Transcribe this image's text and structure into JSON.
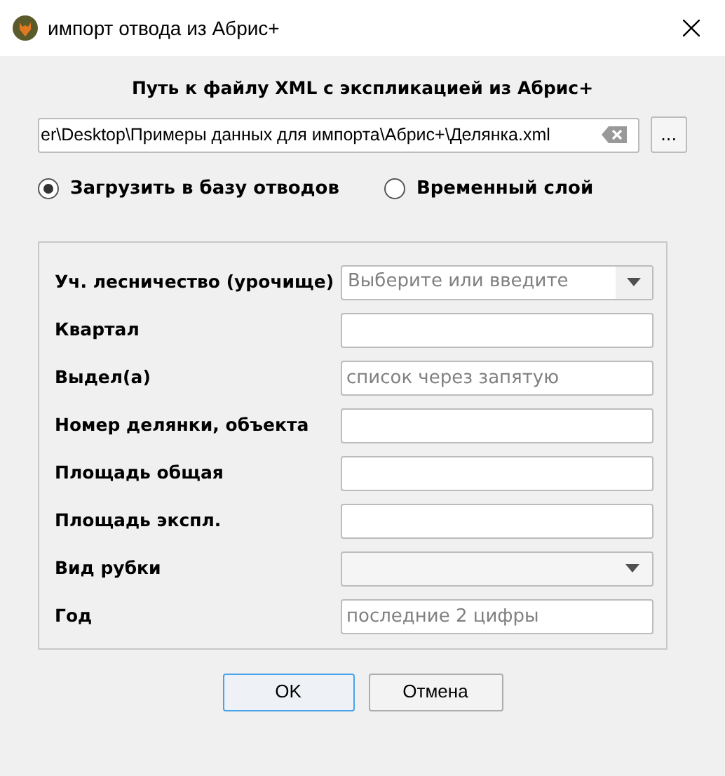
{
  "window": {
    "title": "импорт отвода из Абрис+"
  },
  "path": {
    "label": "Путь к файлу XML с экспликацией из Абрис+",
    "value": "er\\Desktop\\Примеры данных для импорта\\Абрис+\\Делянка.xml",
    "browse": "..."
  },
  "modes": [
    {
      "label": "Загрузить в базу отводов",
      "selected": true
    },
    {
      "label": "Временный слой",
      "selected": false
    }
  ],
  "fields": [
    {
      "label": "Уч. лесничество (урочище)",
      "kind": "combo",
      "placeholder": "Выберите или введите"
    },
    {
      "label": "Квартал",
      "kind": "text"
    },
    {
      "label": "Выдел(а)",
      "kind": "text",
      "placeholder": "список через запятую"
    },
    {
      "label": "Номер делянки, объекта",
      "kind": "text"
    },
    {
      "label": "Площадь общая",
      "kind": "text"
    },
    {
      "label": "Площадь экспл.",
      "kind": "text"
    },
    {
      "label": "Вид рубки",
      "kind": "dropdown"
    },
    {
      "label": "Год",
      "kind": "text",
      "placeholder": "последние 2 цифры"
    }
  ],
  "buttons": [
    {
      "label": "OK",
      "default": true
    },
    {
      "label": "Отмена",
      "default": false
    }
  ]
}
